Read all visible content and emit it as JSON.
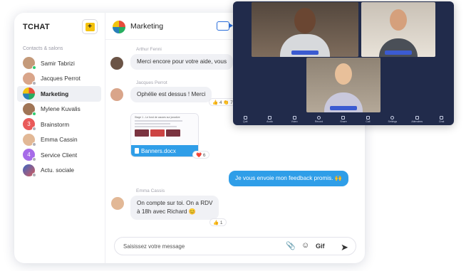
{
  "app": {
    "title": "TCHAT",
    "new_icon": "compose-icon"
  },
  "sidebar": {
    "section_label": "Contacts & salons",
    "items": [
      {
        "label": "Samir Tabrizi",
        "status_color": "#2ecc71"
      },
      {
        "label": "Jacques Perrot",
        "status_color": "#b0b0b8"
      },
      {
        "label": "Marketing",
        "active": true
      },
      {
        "label": "Mylene Kuvalis",
        "status_color": "#2ecc71"
      },
      {
        "label": "Brainstorm",
        "avatar_text": "3",
        "avatar_color": "#e95a5a"
      },
      {
        "label": "Emma Cassin",
        "status_color": "#b0b0b8"
      },
      {
        "label": "Service Client",
        "avatar_text": "4",
        "avatar_color": "#a66be8"
      },
      {
        "label": "Actu. sociale"
      }
    ]
  },
  "chat": {
    "title": "Marketing",
    "video_icon": "video-call-icon",
    "messages": [
      {
        "sender": "Arthur Fenni",
        "text": "Merci encore pour votre aide, vous"
      },
      {
        "sender": "Jacques Perrot",
        "text": "Ophélie est dessus ! Merci",
        "reactions": "👍 4 👏 7"
      },
      {
        "attachment": "Banners.docx",
        "reactions": "❤️ 6",
        "preview_title": "Stage 1 - Le fond de causes sur jonadive"
      },
      {
        "text": "Je vous envoie mon feedback promis. 🙌",
        "mine": true
      },
      {
        "sender": "Emma Cassis",
        "text_lines": [
          "On compte sur toi. On a RDV",
          "à 18h avec Richard 😊"
        ],
        "reactions": "👍 1"
      }
    ],
    "composer": {
      "placeholder": "Saisissez votre message",
      "gif_label": "Gif"
    }
  },
  "video": {
    "controls": [
      "Quit",
      "Audio",
      "Video",
      "Record",
      "Share",
      "Call",
      "Settings",
      "Attendees",
      "Chat"
    ]
  },
  "colors": {
    "accent": "#2f9ee8",
    "video_bg": "#212b4b",
    "online": "#2ecc71"
  }
}
